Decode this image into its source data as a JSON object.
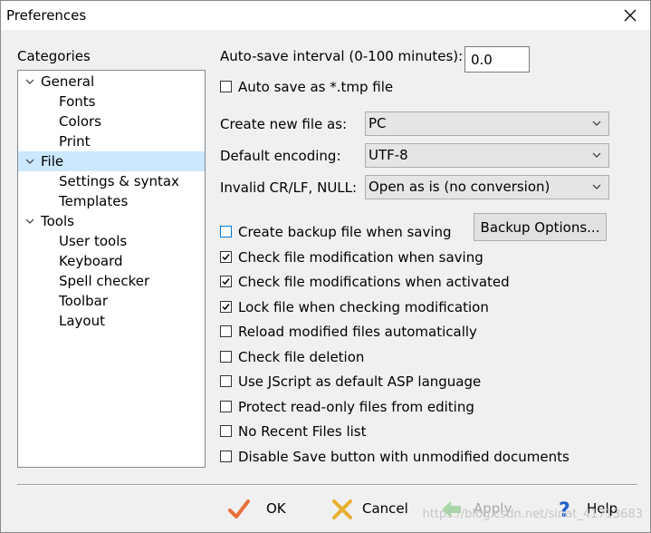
{
  "window": {
    "title": "Preferences"
  },
  "categories": {
    "heading": "Categories",
    "items": [
      {
        "label": "General",
        "expanded": true
      },
      {
        "label": "Fonts"
      },
      {
        "label": "Colors"
      },
      {
        "label": "Print"
      },
      {
        "label": "File",
        "expanded": true,
        "selected": true
      },
      {
        "label": "Settings & syntax"
      },
      {
        "label": "Templates"
      },
      {
        "label": "Tools",
        "expanded": true
      },
      {
        "label": "User tools"
      },
      {
        "label": "Keyboard"
      },
      {
        "label": "Spell checker"
      },
      {
        "label": "Toolbar"
      },
      {
        "label": "Layout"
      }
    ]
  },
  "file": {
    "autosave_label": "Auto-save interval (0-100 minutes):",
    "autosave_value": "0.0",
    "autosave_tmp": {
      "label": "Auto save as *.tmp file",
      "checked": false
    },
    "create_new_label": "Create new file as:",
    "create_new_value": "PC",
    "encoding_label": "Default encoding:",
    "encoding_value": "UTF-8",
    "invalid_label": "Invalid CR/LF, NULL:",
    "invalid_value": "Open as is (no conversion)",
    "backup_options_label": "Backup Options...",
    "checkboxes": [
      {
        "label": "Create backup file when saving",
        "checked": false
      },
      {
        "label": "Check file modification when saving",
        "checked": true
      },
      {
        "label": "Check file modifications when activated",
        "checked": true
      },
      {
        "label": "Lock file when checking modification",
        "checked": true
      },
      {
        "label": "Reload modified files automatically",
        "checked": false
      },
      {
        "label": "Check file deletion",
        "checked": false
      },
      {
        "label": "Use JScript as default ASP language",
        "checked": false
      },
      {
        "label": "Protect read-only files from editing",
        "checked": false
      },
      {
        "label": "No Recent Files list",
        "checked": false
      },
      {
        "label": "Disable Save button with unmodified documents",
        "checked": false
      }
    ]
  },
  "footer": {
    "ok_label": "OK",
    "cancel_label": "Cancel",
    "apply_label": "Apply",
    "help_label": "Help"
  },
  "watermark": "https://blog.csdn.net/sinat_41713683",
  "colors": {
    "selection": "#cce8ff",
    "focus": "#0078d7",
    "ok_icon": "#e8703a",
    "cancel_icon": "#e8b030",
    "help_icon": "#2060c8",
    "apply_icon_disabled": "#a8d8a8"
  },
  "icons": {
    "close": "close-icon",
    "expanded": "chevron-down-icon",
    "combo": "chevron-down-icon",
    "ok": "checkmark-icon",
    "cancel": "cross-icon",
    "apply": "arrow-left-icon",
    "help": "question-mark-icon"
  }
}
